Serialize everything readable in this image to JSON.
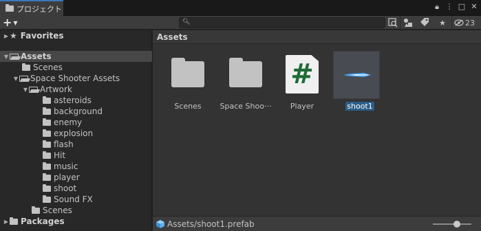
{
  "window": {
    "tab_title": "プロジェクト"
  },
  "toolbar": {
    "add_label": "+",
    "hidden_count": "23"
  },
  "search": {
    "value": ""
  },
  "tree": {
    "favorites": "Favorites",
    "assets": "Assets",
    "scenes": "Scenes",
    "space_shooter": "Space Shooter Assets",
    "artwork": "Artwork",
    "artwork_children": [
      "asteroids",
      "background",
      "enemy",
      "explosion",
      "flash",
      "Hit",
      "music",
      "player",
      "shoot",
      "Sound FX"
    ],
    "scenes_inner": "Scenes",
    "packages": "Packages"
  },
  "breadcrumb": {
    "current": "Assets"
  },
  "assets": [
    {
      "label": "Scenes",
      "kind": "folder"
    },
    {
      "label": "Space Shoo···",
      "kind": "folder"
    },
    {
      "label": "Player",
      "kind": "script"
    },
    {
      "label": "shoot1",
      "kind": "prefab",
      "selected": true
    }
  ],
  "status": {
    "path": "Assets/shoot1.prefab",
    "zoom_fraction": 0.65
  },
  "colors": {
    "accent": "#3a79bb",
    "selection": "#2c5d87",
    "script_hash": "#1f6b34"
  }
}
